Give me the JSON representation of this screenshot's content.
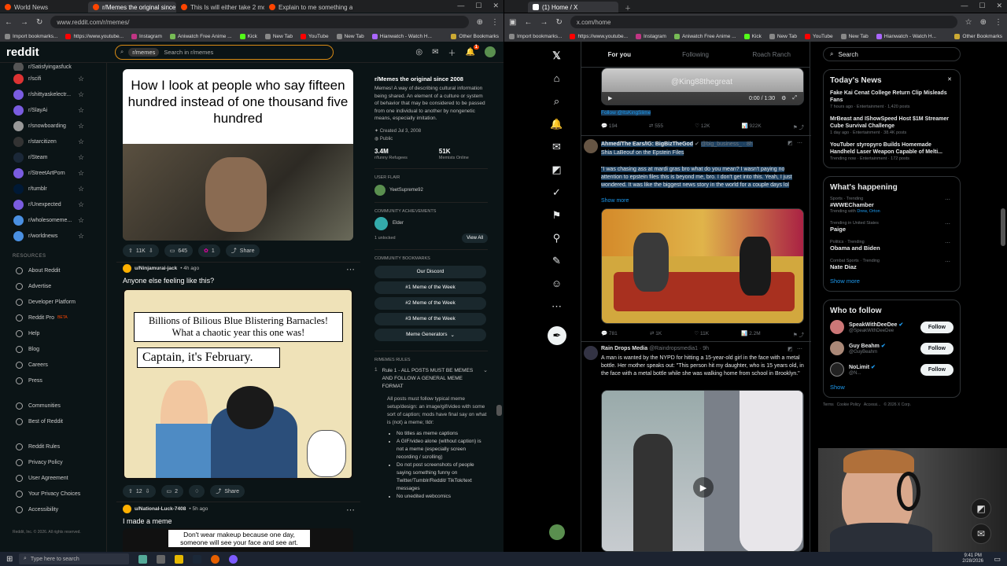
{
  "left_browser": {
    "tabs": [
      {
        "title": "World News",
        "active": false
      },
      {
        "title": "r/Memes the original since 20",
        "active": true
      },
      {
        "title": "This Is will either take 2 month",
        "active": false
      },
      {
        "title": "Explain to me something abou",
        "active": false
      }
    ],
    "url": "www.reddit.com/r/memes/",
    "bookmarks": [
      "Import bookmarks...",
      "https://www.youtube...",
      "Instagram",
      "Aniwatch Free Anime ...",
      "Kick",
      "New Tab",
      "YouTube",
      "New Tab",
      "Hianwatch - Watch H..."
    ],
    "other_bookmarks": "Other Bookmarks"
  },
  "reddit": {
    "logo": "reddit",
    "search_chip": "r/memes",
    "search_placeholder": "Search in r/memes",
    "notif_count": "1",
    "sidebar_subs": [
      "r/Satisfyingasfuck",
      "r/scifi",
      "r/shittyaskelectr...",
      "r/SlayAi",
      "r/snowboarding",
      "r/starcitizen",
      "r/Steam",
      "r/StreetArtPorn",
      "r/tumblr",
      "r/Unexpected",
      "r/wholesomeme...",
      "r/worldnews"
    ],
    "resources_label": "RESOURCES",
    "resources": [
      "About Reddit",
      "Advertise",
      "Developer Platform",
      "Reddit Pro",
      "Help",
      "Blog",
      "Careers",
      "Press"
    ],
    "reddit_pro_badge": "BETA",
    "more_links": [
      "Communities",
      "Best of Reddit"
    ],
    "legal_links": [
      "Reddit Rules",
      "Privacy Policy",
      "User Agreement",
      "Your Privacy Choices",
      "Accessibility"
    ],
    "copyright": "Reddit, Inc. © 2026. All rights reserved.",
    "post1": {
      "caption": "How I look at people who say fifteen hundred instead of one thousand five hundred",
      "votes": "11K",
      "comments": "645",
      "awards": "1",
      "share": "Share"
    },
    "post2": {
      "user": "u/Ninjamurai-jack",
      "time": "• 4h ago",
      "title": "Anyone else feeling like this?",
      "bubble1": "Billions of Bilious Blue Blistering Barnacles! What a chaotic year this one was!",
      "bubble2": "Captain, it's February.",
      "votes": "12",
      "comments": "2",
      "share": "Share"
    },
    "post3": {
      "user": "u/National-Luck-7408",
      "time": "• 5h ago",
      "title": "I made a meme",
      "caption": "Don't wear makeup because one day, someone will see your face and see art."
    },
    "community": {
      "name": "r/Memes the original since 2008",
      "description": "Memes! A way of describing cultural information being shared. An element of a culture or system of behavior that may be considered to be passed from one individual to another by nongenetic means, especially imitation.",
      "created": "Created Jul 3, 2008",
      "visibility": "Public",
      "members": "3.4M",
      "members_label": "r/funny Refugees",
      "online": "51K",
      "online_label": "Memists Online",
      "user_flair_label": "USER FLAIR",
      "user_flair": "YeetSupreme92",
      "achievements_label": "COMMUNITY ACHIEVEMENTS",
      "achievement": "Elder",
      "unlocked": "1 unlocked",
      "view_all": "View All",
      "bookmarks_label": "COMMUNITY BOOKMARKS",
      "bookmarks": [
        "Our Discord",
        "#1 Meme of the Week",
        "#2 Meme of the Week",
        "#3 Meme of the Week",
        "Meme Generators"
      ],
      "rules_label": "R/MEMES RULES",
      "rule1_title": "Rule 1 - ALL POSTS MUST BE MEMES AND FOLLOW A GENERAL MEME FORMAT",
      "rule1_body": "All posts must follow typical meme setup/design: an image/gif/video with some sort of caption; mods have final say on what is (not) a meme; tldr:",
      "rule_bullets": [
        "No titles as meme captions",
        "A GIF/video alone (without caption) is not a meme (especially screen recording / scrolling)",
        "Do not post screenshots of people saying something funny on Twitter/Tumblr/Reddit/ TikTok/text messages",
        "No unedited webcomics"
      ]
    }
  },
  "right_browser": {
    "tab_title": "(1) Home / X",
    "url": "x.com/home",
    "bookmarks": [
      "Import bookmarks...",
      "https://www.youtube...",
      "Instagram",
      "Aniwatch Free Anime ...",
      "Kick",
      "New Tab",
      "YouTube",
      "New Tab",
      "Hianwatch - Watch H..."
    ],
    "other_bookmarks": "Other Bookmarks"
  },
  "x": {
    "tabs": [
      "For you",
      "Following",
      "Roach Ranch"
    ],
    "tweet0": {
      "video_time": "0:00 / 1:30",
      "watermark": "@King88thegreat",
      "follow_line": "Follow @ItsKingSlime",
      "stats": [
        "194",
        "555",
        "12K",
        "922K"
      ]
    },
    "tweet1": {
      "name": "Ahmed/The Ears/IG: BigBizTheGod",
      "handle": "@big_business_ · 8h",
      "subtitle": "Shia LaBeouf on the Epstein Files",
      "text": "\"I was chasing ass at mardi gras bro what do you mean? I wasn't paying no attention to epstein files  this is beyond me, bro. I don't get into this. Yeah, I just wondered. It was like the biggest news story in the world for a couple days lol",
      "show_more": "Show more",
      "stats": [
        "781",
        "1K",
        "11K",
        "2.2M"
      ]
    },
    "tweet2": {
      "name": "Rain Drops Media",
      "handle": "@Raindropsmedia1 · 9h",
      "text": "A man is wanted by the NYPD for hitting a 15-year-old girl in the face with a metal bottle. Her mother speaks out: \"This person hit my daughter, who is 15 years old, in the face with a metal bottle while she was walking home from school in Brooklyn.\""
    },
    "search_placeholder": "Search",
    "news": {
      "title": "Today's News",
      "items": [
        {
          "headline": "Fake Kai Cenat College Return Clip Misleads Fans",
          "meta": "7 hours ago · Entertainment · 1,420 posts"
        },
        {
          "headline": "MrBeast and IShowSpeed Host $1M Streamer Cube Survival Challenge",
          "meta": "1 day ago · Entertainment · 38.4K posts"
        },
        {
          "headline": "YouTuber styropyro Builds Homemade Handheld Laser Weapon Capable of Melti...",
          "meta": "Trending now · Entertainment · 172 posts"
        }
      ]
    },
    "happening": {
      "title": "What's happening",
      "items": [
        {
          "context": "Sports · Trending",
          "topic": "#WWEChamber",
          "extra_prefix": "Trending with ",
          "extra_link": "Drew, Orton"
        },
        {
          "context": "Trending in United States",
          "topic": "Paige",
          "extra_prefix": "",
          "extra_link": ""
        },
        {
          "context": "Politics · Trending",
          "topic": "Obama and Biden",
          "extra_prefix": "",
          "extra_link": ""
        },
        {
          "context": "Combat Sports · Trending",
          "topic": "Nate Diaz",
          "extra_prefix": "",
          "extra_link": ""
        }
      ],
      "show_more": "Show more"
    },
    "who_to_follow": {
      "title": "Who to follow",
      "users": [
        {
          "name": "SpeakWithDeeDee",
          "handle": "@SpeakWithDeeDee",
          "button": "Follow"
        },
        {
          "name": "Guy Beahm",
          "handle": "@GuyBeahm",
          "button": "Follow"
        },
        {
          "name": "NoLimit",
          "handle": "@N...",
          "button": "Follow"
        }
      ],
      "show_more": "Show"
    },
    "footer": [
      "Terms",
      "Cookie Policy",
      "Accessi...",
      "© 2026 X Corp."
    ]
  },
  "taskbar": {
    "search_placeholder": "Type here to search",
    "time": "9:41 PM",
    "date": "2/28/2026"
  },
  "colors": {
    "reddit_bg": "#0b1416",
    "reddit_orange": "#ff4500",
    "x_blue": "#1d9bf0",
    "x_bg": "#000000"
  }
}
